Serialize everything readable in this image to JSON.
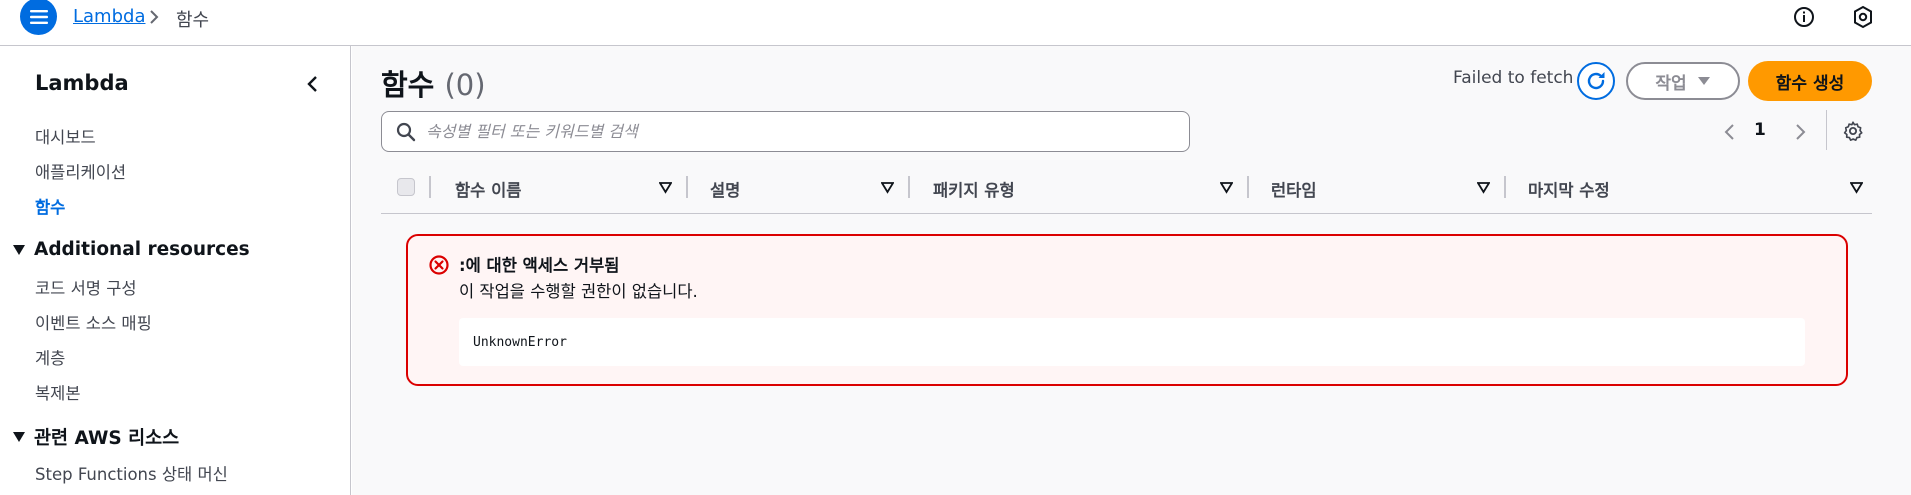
{
  "header": {
    "breadcrumb_service": "Lambda",
    "breadcrumb_current": "함수",
    "icons": [
      "menu-icon",
      "chevron-right-icon",
      "info-icon",
      "settings-shield-icon"
    ]
  },
  "sidebar": {
    "title": "Lambda",
    "items": [
      {
        "label": "대시보드"
      },
      {
        "label": "애플리케이션"
      },
      {
        "label": "함수",
        "active": true
      }
    ],
    "additional_resources": {
      "heading": "Additional resources",
      "items": [
        {
          "label": "코드 서명 구성"
        },
        {
          "label": "이벤트 소스 매핑"
        },
        {
          "label": "계층"
        },
        {
          "label": "복제본"
        }
      ]
    },
    "related_aws": {
      "heading": "관련 AWS 리소스",
      "items": [
        {
          "label": "Step Functions 상태 머신"
        }
      ]
    }
  },
  "main": {
    "title": "함수",
    "count": "(0)",
    "fetch_status": "Failed to fetch",
    "actions_label": "작업",
    "create_label": "함수 생성",
    "search": {
      "placeholder": "속성별 필터 또는 키워드별 검색",
      "value": ""
    },
    "pagination": {
      "current_page": "1"
    },
    "columns": [
      "함수 이름",
      "설명",
      "패키지 유형",
      "런타임",
      "마지막 수정"
    ],
    "error": {
      "title": ":에 대한 액세스 거부됨",
      "message": "이 작업을 수행할 권한이 없습니다.",
      "code": "UnknownError"
    }
  },
  "colors": {
    "accent": "#006ce0",
    "primary_button": "#ff9900",
    "error_border": "#db0000",
    "error_background": "#fff5f5"
  }
}
